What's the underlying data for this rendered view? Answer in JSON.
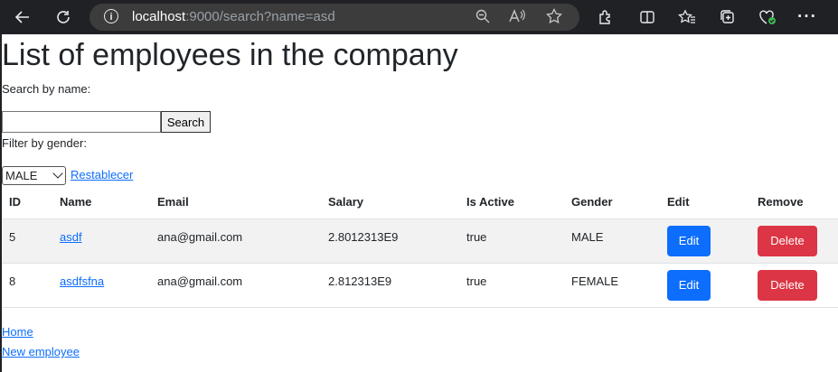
{
  "browser": {
    "url_host": "localhost",
    "url_rest": ":9000/search?name=asd"
  },
  "page": {
    "title": "List of employees in the company",
    "search_label": "Search by name:",
    "search_value": "",
    "search_button": "Search",
    "filter_label": "Filter by gender:",
    "gender_selected": "MALE",
    "reset_link": "Restablecer"
  },
  "table": {
    "headers": {
      "id": "ID",
      "name": "Name",
      "email": "Email",
      "salary": "Salary",
      "active": "Is Active",
      "gender": "Gender",
      "edit": "Edit",
      "remove": "Remove"
    },
    "rows": [
      {
        "id": "5",
        "name": "asdf",
        "email": "ana@gmail.com",
        "salary": "2.8012313E9",
        "active": "true",
        "gender": "MALE",
        "edit": "Edit",
        "remove": "Delete"
      },
      {
        "id": "8",
        "name": "asdfsfna",
        "email": "ana@gmail.com",
        "salary": "2.812313E9",
        "active": "true",
        "gender": "FEMALE",
        "edit": "Edit",
        "remove": "Delete"
      }
    ]
  },
  "footer": {
    "home": "Home",
    "new_employee": "New employee"
  }
}
